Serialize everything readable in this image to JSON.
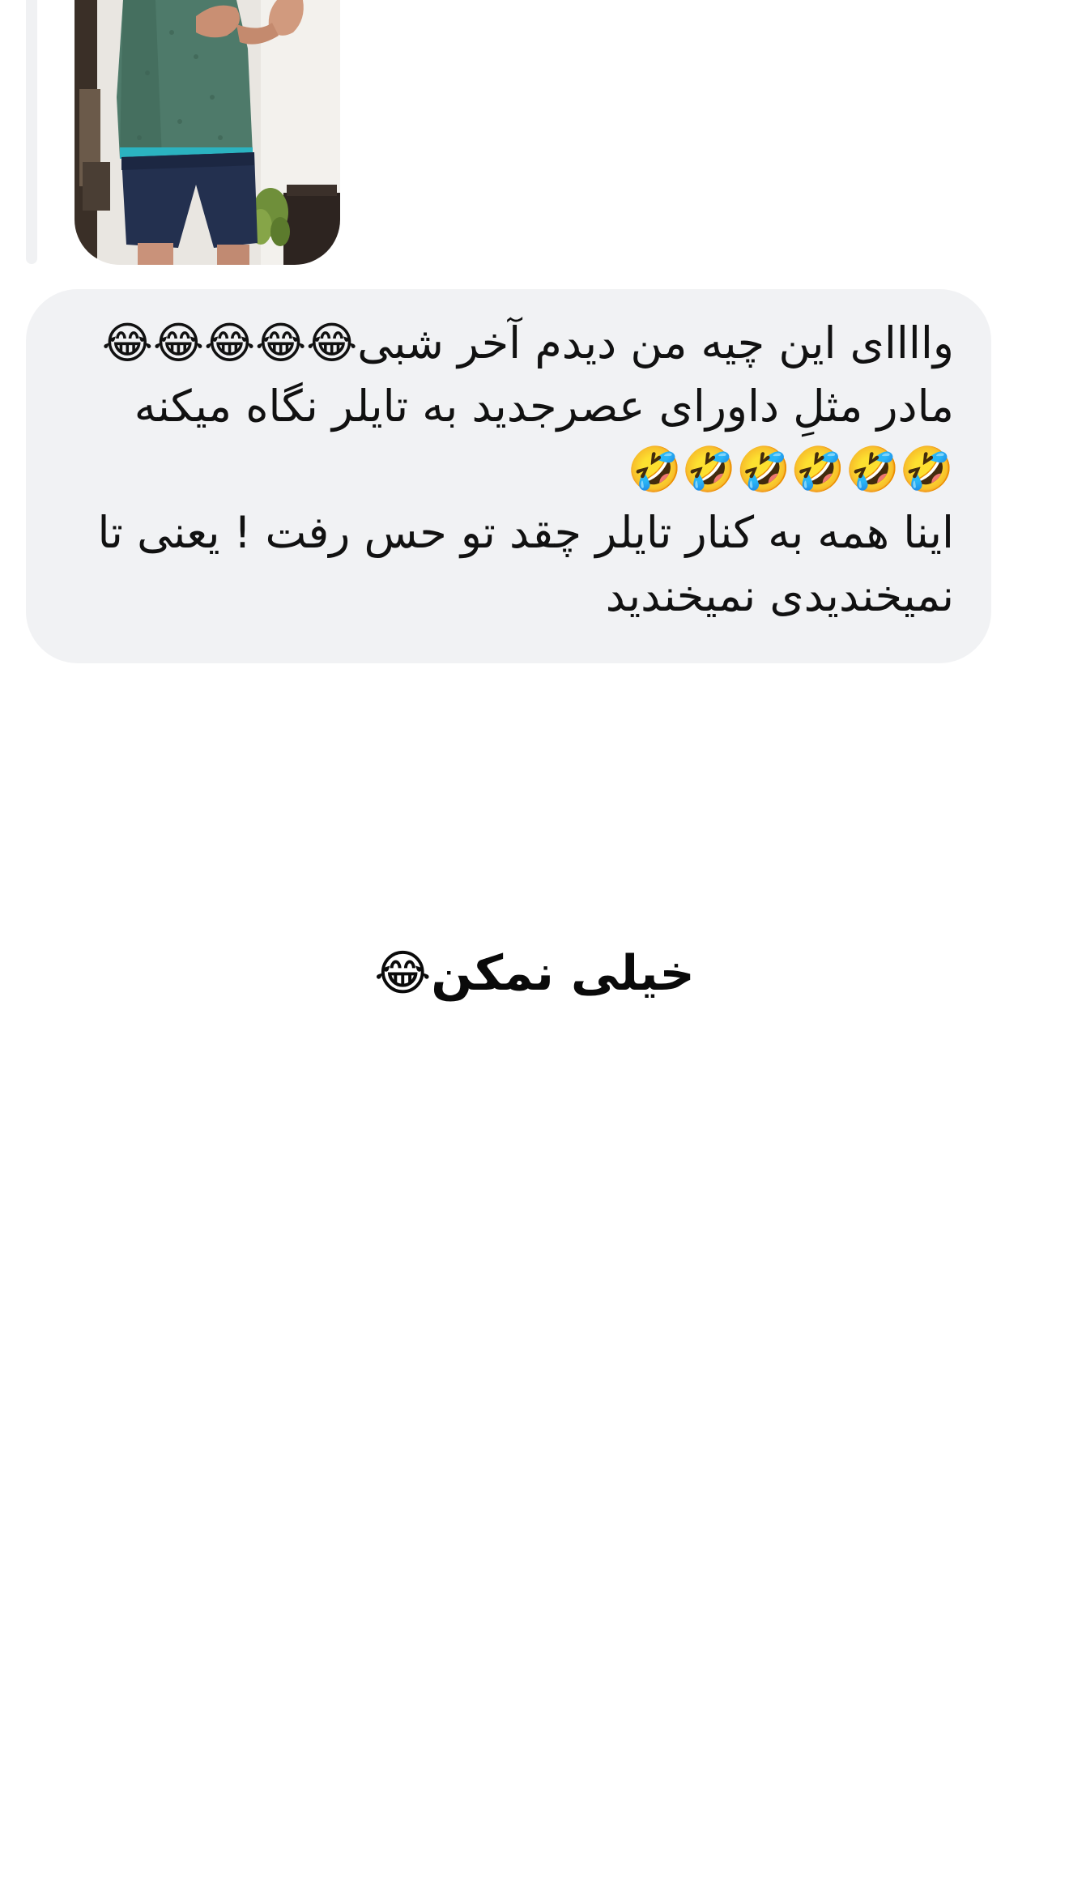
{
  "shared_video": {
    "icon": "video-thumbnail"
  },
  "message": {
    "lines": [
      "وااااى اين چيه من ديدم آخر شبى😂😂😂😂😂",
      "مادر مثلِ داوراى عصرجديد به تايلر نگاه ميكنه",
      "🤣🤣🤣🤣🤣🤣",
      "اينا همه به كنار تايلر چقد تو حس رفت ! يعنى تا",
      "نميخنديدى نميخنديد"
    ],
    "bubble_color": "#f1f2f4"
  },
  "caption": {
    "text": "خیلی نمکن😂"
  }
}
